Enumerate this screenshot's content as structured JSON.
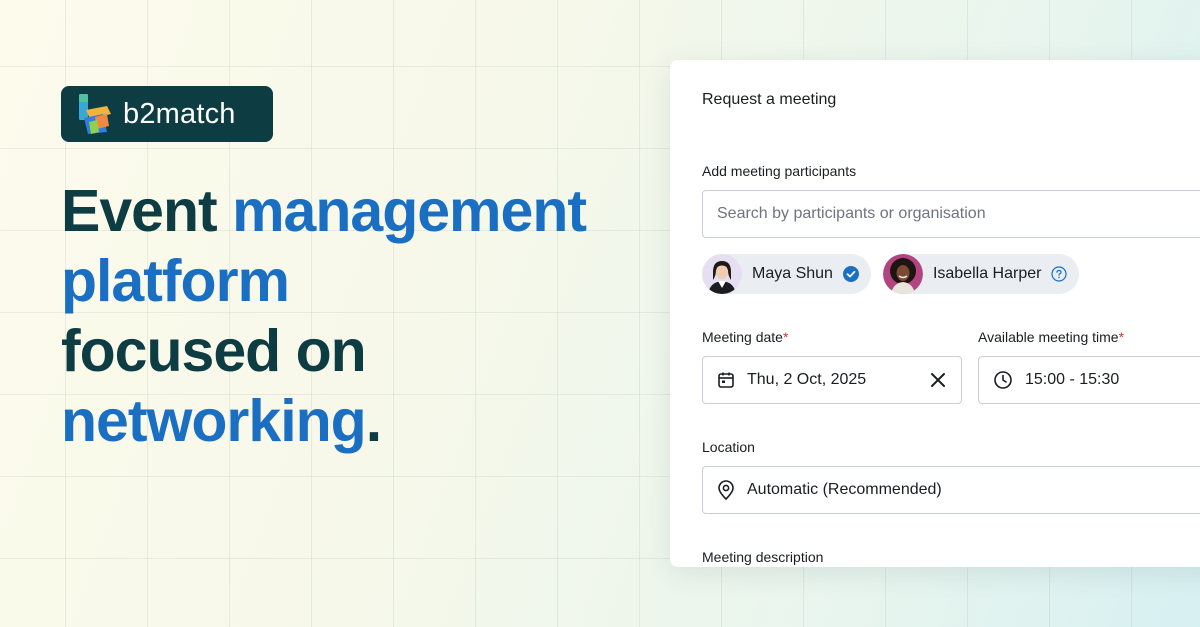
{
  "brand": {
    "name": "b2match"
  },
  "headline": {
    "line1_dark": "Event ",
    "line1_accent": "management",
    "line2_accent": "platform",
    "line3_dark": "focused on",
    "line4_accent": "networking",
    "line4_dark": "."
  },
  "colors": {
    "brand_dark": "#0d3c42",
    "accent_blue": "#1a6fc2",
    "required_red": "#d33434"
  },
  "meeting_form": {
    "title": "Request a meeting",
    "participants": {
      "label": "Add meeting participants",
      "search_placeholder": "Search by participants or organisation",
      "selected": [
        {
          "name": "Maya Shun",
          "status_icon": "check-circle-icon"
        },
        {
          "name": "Isabella Harper",
          "status_icon": "question-circle-icon"
        }
      ]
    },
    "date": {
      "label": "Meeting date",
      "required": "*",
      "value": "Thu, 2 Oct, 2025",
      "icon": "calendar-icon",
      "clear_icon": "close-icon"
    },
    "time": {
      "label": "Available meeting time",
      "required": "*",
      "value": "15:00 - 15:30",
      "icon": "clock-icon"
    },
    "location": {
      "label": "Location",
      "value": "Automatic (Recommended)",
      "icon": "location-pin-icon"
    },
    "description": {
      "label": "Meeting description"
    }
  }
}
